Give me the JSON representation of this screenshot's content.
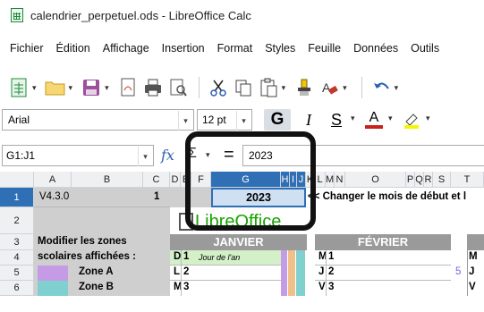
{
  "window": {
    "title": "calendrier_perpetuel.ods - LibreOffice Calc"
  },
  "menu": [
    "Fichier",
    "Édition",
    "Affichage",
    "Insertion",
    "Format",
    "Styles",
    "Feuille",
    "Données",
    "Outils"
  ],
  "toolbar2": {
    "font_name": "Arial",
    "font_size": "12 pt",
    "bold": "G",
    "italic": "I",
    "underline": "S",
    "font_color_letter": "A"
  },
  "formula": {
    "name_box": "G1:J1",
    "fx": "fx",
    "sigma": "Σ",
    "equals": "=",
    "value": "2023"
  },
  "columns": [
    "A",
    "B",
    "C",
    "D",
    "E",
    "F",
    "G",
    "H",
    "I",
    "J",
    "K",
    "L",
    "M",
    "N",
    "O",
    "P",
    "Q",
    "R",
    "S",
    "T"
  ],
  "rows": [
    "1",
    "2",
    "3",
    "4",
    "5",
    "6"
  ],
  "cells": {
    "a1": "V4.3.0",
    "c1": "1",
    "g1": "2023",
    "k1": "<< Changer le mois de début et l",
    "logo": "LibreOffice",
    "a3": "Modifier les zones",
    "a4": "scolaires affichées :",
    "zone_a": "Zone A",
    "zone_b": "Zone B",
    "jan": "JANVIER",
    "feb": "FÉVRIER",
    "d4": "D",
    "e4": "1",
    "f4": "Jour de l'an",
    "d5": "L",
    "e5": "2",
    "d6": "M",
    "e6": "3",
    "l4": "M",
    "m4": "1",
    "l5": "J",
    "m5": "2",
    "l6": "V",
    "m6": "3",
    "s5": "5",
    "t4": "M",
    "t5": "J",
    "t6": "V"
  },
  "colors": {
    "selection": "#2f6fb5",
    "month_header": "#9a9a9a",
    "zone_a": "#c59be6",
    "zone_b": "#7fd0cf",
    "green_cell": "#d3f0c8"
  }
}
